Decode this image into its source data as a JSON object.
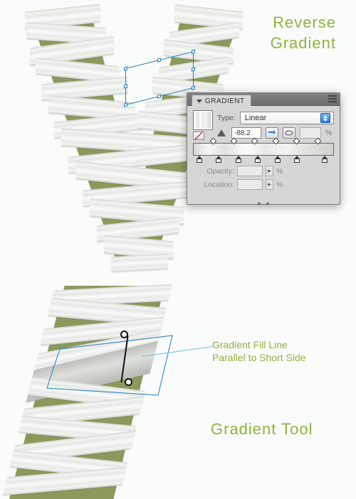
{
  "labels": {
    "reverseGradient_l1": "Reverse",
    "reverseGradient_l2": "Gradient",
    "gradientTool": "Gradient Tool",
    "callout_l1": "Gradient Fill Line",
    "callout_l2": "Parallel to Short Side"
  },
  "panel": {
    "title": "GRADIENT",
    "typeLabel": "Type:",
    "typeValue": "Linear",
    "angleValue": "-88.2",
    "ratioValue": "",
    "pctSymbol": "%",
    "opacityLabel": "Opacity:",
    "locationLabel": "Location:"
  }
}
